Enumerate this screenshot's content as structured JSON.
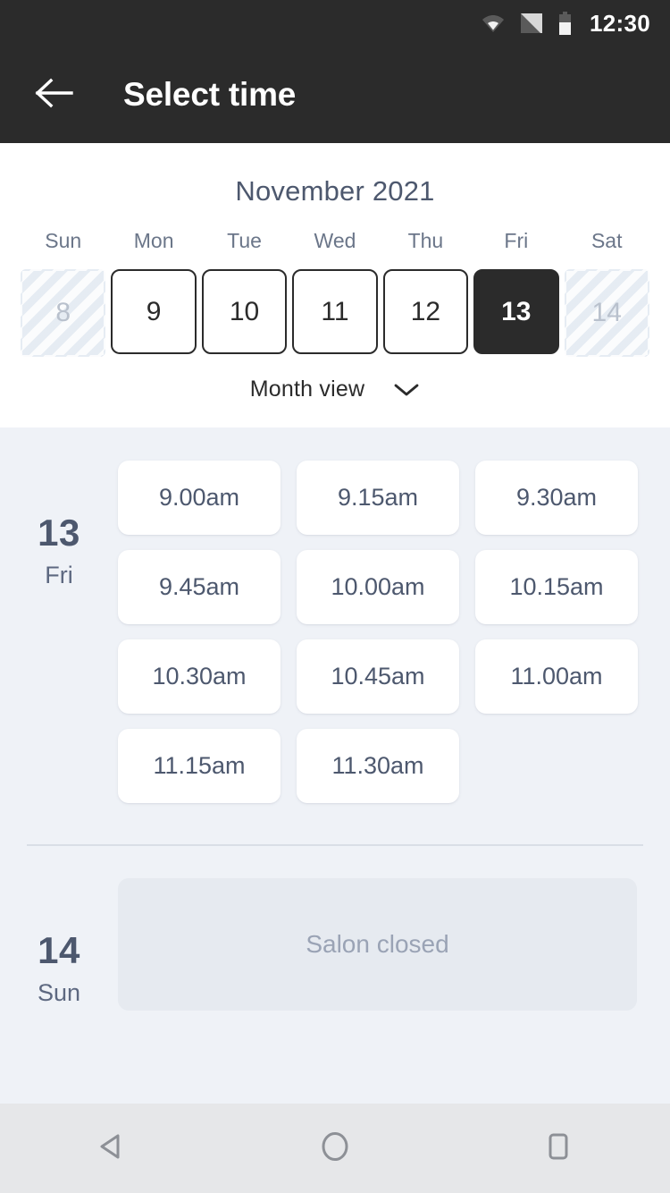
{
  "status_bar": {
    "time": "12:30",
    "icons": [
      "wifi-icon",
      "signal-icon",
      "battery-icon"
    ]
  },
  "app_bar": {
    "back_icon": "back-arrow-icon",
    "title": "Select time"
  },
  "calendar": {
    "month_label": "November 2021",
    "weekdays": [
      "Sun",
      "Mon",
      "Tue",
      "Wed",
      "Thu",
      "Fri",
      "Sat"
    ],
    "days": [
      {
        "number": "8",
        "state": "disabled"
      },
      {
        "number": "9",
        "state": "enabled"
      },
      {
        "number": "10",
        "state": "enabled"
      },
      {
        "number": "11",
        "state": "enabled"
      },
      {
        "number": "12",
        "state": "enabled"
      },
      {
        "number": "13",
        "state": "selected"
      },
      {
        "number": "14",
        "state": "disabled"
      }
    ],
    "view_toggle": {
      "label": "Month view",
      "chevron_icon": "chevron-down-icon"
    }
  },
  "schedule": {
    "groups": [
      {
        "day_number": "13",
        "day_of_week": "Fri",
        "slots": [
          "9.00am",
          "9.15am",
          "9.30am",
          "9.45am",
          "10.00am",
          "10.15am",
          "10.30am",
          "10.45am",
          "11.00am",
          "11.15am",
          "11.30am"
        ]
      },
      {
        "day_number": "14",
        "day_of_week": "Sun",
        "closed_label": "Salon closed"
      }
    ]
  },
  "nav_bar": {
    "back_label": "back-triangle-icon",
    "home_label": "home-circle-icon",
    "recents_label": "recents-square-icon"
  },
  "colors": {
    "app_bar_bg": "#2b2b2b",
    "panel_bg": "#ffffff",
    "slots_bg": "#eff2f7",
    "text_primary": "#4d586e",
    "selected_day_bg": "#2b2b2b",
    "closed_card_bg": "#e6eaf0",
    "nav_bar_bg": "#e6e7e9"
  }
}
